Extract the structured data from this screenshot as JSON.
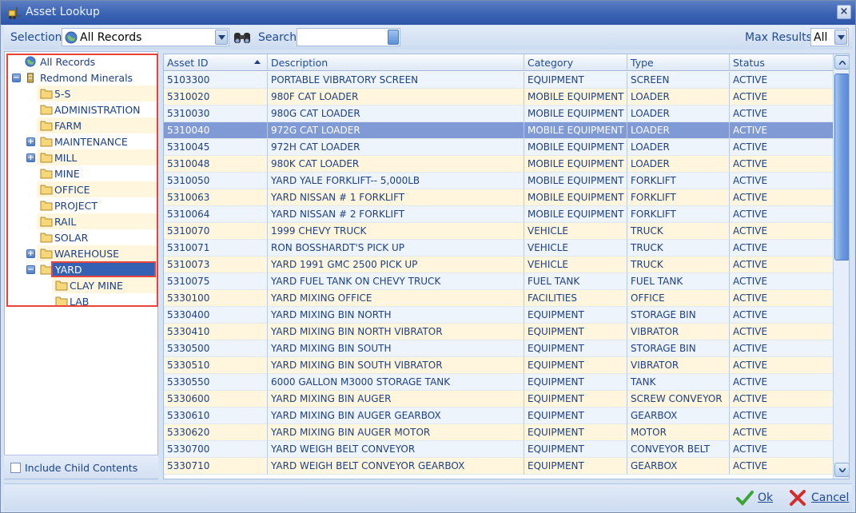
{
  "window": {
    "title": "Asset Lookup",
    "close_label": "×"
  },
  "toolbar": {
    "selection_label": "Selection",
    "selection_value": "All Records",
    "search_label": "Search",
    "search_value": "",
    "max_results_label": "Max Results",
    "max_results_value": "All"
  },
  "tree": {
    "items": [
      {
        "label": "All Records",
        "icon": "globe-icon"
      },
      {
        "label": "Redmond Minerals",
        "icon": "building-icon",
        "expander": "-"
      },
      {
        "label": "5-S"
      },
      {
        "label": "ADMINISTRATION"
      },
      {
        "label": "FARM"
      },
      {
        "label": "MAINTENANCE",
        "expander": "+"
      },
      {
        "label": "MILL",
        "expander": "+"
      },
      {
        "label": "MINE"
      },
      {
        "label": "OFFICE"
      },
      {
        "label": "PROJECT"
      },
      {
        "label": "RAIL"
      },
      {
        "label": "SOLAR"
      },
      {
        "label": "WAREHOUSE",
        "expander": "+"
      },
      {
        "label": "YARD",
        "expander": "-",
        "selected": true
      },
      {
        "label": "CLAY MINE"
      },
      {
        "label": "LAB"
      }
    ],
    "include_child_label": "Include Child Contents"
  },
  "grid": {
    "columns": [
      "Asset ID",
      "Description",
      "Category",
      "Type",
      "Status"
    ],
    "rows": [
      [
        "5103300",
        "PORTABLE VIBRATORY SCREEN",
        "EQUIPMENT",
        "SCREEN",
        "ACTIVE"
      ],
      [
        "5310020",
        "980F CAT LOADER",
        "MOBILE EQUIPMENT",
        "LOADER",
        "ACTIVE"
      ],
      [
        "5310030",
        "980G CAT LOADER",
        "MOBILE EQUIPMENT",
        "LOADER",
        "ACTIVE"
      ],
      [
        "5310040",
        "972G CAT LOADER",
        "MOBILE EQUIPMENT",
        "LOADER",
        "ACTIVE"
      ],
      [
        "5310045",
        "972H CAT LOADER",
        "MOBILE EQUIPMENT",
        "LOADER",
        "ACTIVE"
      ],
      [
        "5310048",
        "980K CAT LOADER",
        "MOBILE EQUIPMENT",
        "LOADER",
        "ACTIVE"
      ],
      [
        "5310050",
        "YARD YALE FORKLIFT-- 5,000LB",
        "MOBILE EQUIPMENT",
        "FORKLIFT",
        "ACTIVE"
      ],
      [
        "5310063",
        "YARD NISSAN # 1 FORKLIFT",
        "MOBILE EQUIPMENT",
        "FORKLIFT",
        "ACTIVE"
      ],
      [
        "5310064",
        "YARD NISSAN # 2 FORKLIFT",
        "MOBILE EQUIPMENT",
        "FORKLIFT",
        "ACTIVE"
      ],
      [
        "5310070",
        "1999 CHEVY TRUCK",
        "VEHICLE",
        "TRUCK",
        "ACTIVE"
      ],
      [
        "5310071",
        "RON BOSSHARDT'S PICK UP",
        "VEHICLE",
        "TRUCK",
        "ACTIVE"
      ],
      [
        "5310073",
        "YARD 1991 GMC 2500 PICK UP",
        "VEHICLE",
        "TRUCK",
        "ACTIVE"
      ],
      [
        "5310075",
        "YARD FUEL TANK ON CHEVY TRUCK",
        "FUEL TANK",
        "FUEL TANK",
        "ACTIVE"
      ],
      [
        "5330100",
        "YARD MIXING OFFICE",
        "FACILITIES",
        "OFFICE",
        "ACTIVE"
      ],
      [
        "5330400",
        "YARD MIXING BIN NORTH",
        "EQUIPMENT",
        "STORAGE BIN",
        "ACTIVE"
      ],
      [
        "5330410",
        "YARD MIXING BIN NORTH VIBRATOR",
        "EQUIPMENT",
        "VIBRATOR",
        "ACTIVE"
      ],
      [
        "5330500",
        "YARD MIXING BIN SOUTH",
        "EQUIPMENT",
        "STORAGE BIN",
        "ACTIVE"
      ],
      [
        "5330510",
        "YARD MIXING BIN SOUTH VIBRATOR",
        "EQUIPMENT",
        "VIBRATOR",
        "ACTIVE"
      ],
      [
        "5330550",
        "6000 GALLON M3000 STORAGE TANK",
        "EQUIPMENT",
        "TANK",
        "ACTIVE"
      ],
      [
        "5330600",
        "YARD MIXING BIN AUGER",
        "EQUIPMENT",
        "SCREW CONVEYOR",
        "ACTIVE"
      ],
      [
        "5330610",
        "YARD MIXING BIN AUGER GEARBOX",
        "EQUIPMENT",
        "GEARBOX",
        "ACTIVE"
      ],
      [
        "5330620",
        "YARD MIXING BIN AUGER MOTOR",
        "EQUIPMENT",
        "MOTOR",
        "ACTIVE"
      ],
      [
        "5330700",
        "YARD WEIGH BELT CONVEYOR",
        "EQUIPMENT",
        "CONVEYOR BELT",
        "ACTIVE"
      ],
      [
        "5330710",
        "YARD WEIGH BELT CONVEYOR GEARBOX",
        "EQUIPMENT",
        "GEARBOX",
        "ACTIVE"
      ]
    ],
    "selected_row": 3
  },
  "buttons": {
    "ok_label": "Ok",
    "cancel_label": "Cancel"
  },
  "colors": {
    "selection": "#3561b4",
    "row_alt": "#fff6dd",
    "highlight_frame": "#e8443a"
  }
}
